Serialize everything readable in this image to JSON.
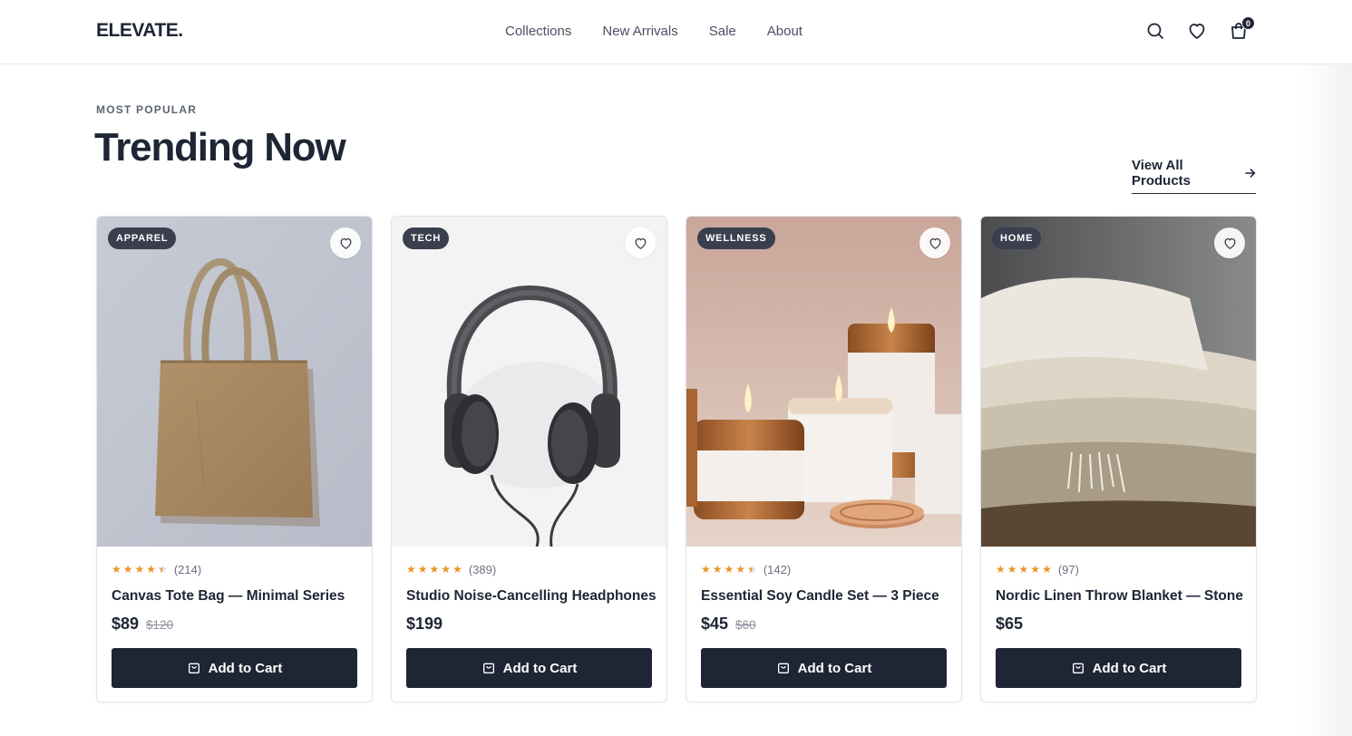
{
  "header": {
    "logo": "ELEVATE.",
    "nav": [
      "Collections",
      "New Arrivals",
      "Sale",
      "About"
    ],
    "icons": [
      "search-icon",
      "heart-icon",
      "shopping-bag-icon"
    ],
    "cart_count": "0"
  },
  "section": {
    "eyebrow": "MOST POPULAR",
    "title": "Trending Now",
    "view_all": "View All Products",
    "view_all_icon": "arrow-right-icon"
  },
  "colors": {
    "primary": "#1e2535",
    "star": "#e8952a",
    "badge": "#3a3f4f",
    "muted": "#8a909c"
  },
  "products": [
    {
      "category": "APPAREL",
      "rating": 4.5,
      "reviews": "(214)",
      "name": "Canvas Tote Bag — Minimal Series",
      "price": "$89",
      "old_price": "$120",
      "button": "Add to Cart"
    },
    {
      "category": "TECH",
      "rating": 5,
      "reviews": "(389)",
      "name": "Studio Noise-Cancelling Headphones",
      "price": "$199",
      "old_price": "",
      "button": "Add to Cart"
    },
    {
      "category": "WELLNESS",
      "rating": 4.5,
      "reviews": "(142)",
      "name": "Essential Soy Candle Set — 3 Piece",
      "price": "$45",
      "old_price": "$60",
      "button": "Add to Cart"
    },
    {
      "category": "HOME",
      "rating": 5,
      "reviews": "(97)",
      "name": "Nordic Linen Throw Blanket — Stone",
      "price": "$65",
      "old_price": "",
      "button": "Add to Cart"
    }
  ]
}
